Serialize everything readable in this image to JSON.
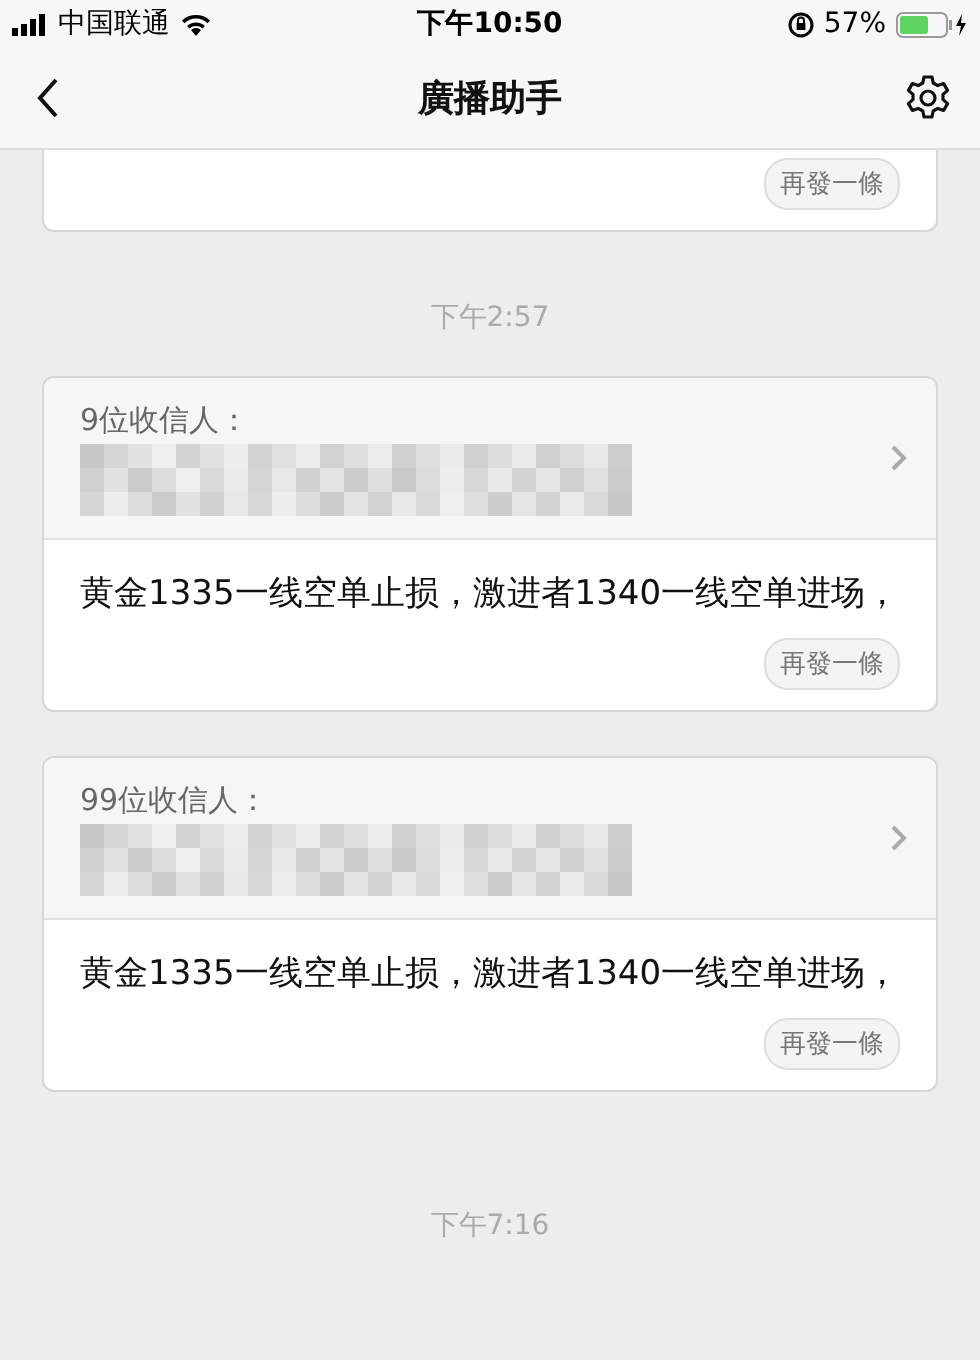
{
  "status_bar": {
    "carrier": "中国联通",
    "time": "下午10:50",
    "battery": "57%"
  },
  "nav": {
    "title": "廣播助手"
  },
  "feed": [
    {
      "kind": "card",
      "resend": "再發一條"
    },
    {
      "kind": "time",
      "text": "下午2:57"
    },
    {
      "kind": "card",
      "recipients": "9位收信人：",
      "message": "黄金1335一线空单止损，激进者1340一线空单进场，",
      "resend": "再發一條"
    },
    {
      "kind": "card",
      "recipients": "99位收信人：",
      "message": "黄金1335一线空单止损，激进者1340一线空单进场，",
      "resend": "再發一條"
    },
    {
      "kind": "time",
      "text": "下午7:16"
    }
  ]
}
